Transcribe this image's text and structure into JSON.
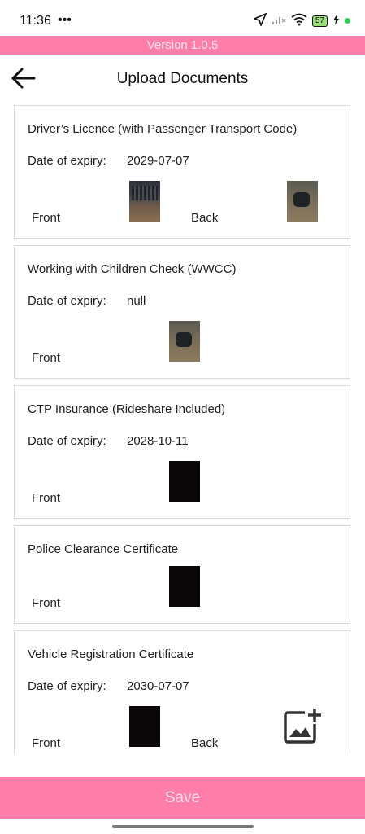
{
  "status": {
    "time": "11:36",
    "extra": "•••",
    "battery": "57"
  },
  "version": "Version 1.0.5",
  "header": {
    "title": "Upload Documents"
  },
  "labels": {
    "expiry": "Date of expiry:",
    "front": "Front",
    "back": "Back"
  },
  "documents": [
    {
      "title": "Driver’s Licence (with Passenger Transport Code)",
      "expiry": "2029-07-07"
    },
    {
      "title": "Working with Children Check (WWCC)",
      "expiry": "null"
    },
    {
      "title": "CTP Insurance (Rideshare Included)",
      "expiry": "2028-10-11"
    },
    {
      "title": "Police Clearance Certificate"
    },
    {
      "title": "Vehicle Registration Certificate",
      "expiry": "2030-07-07"
    }
  ],
  "save_label": "Save",
  "colors": {
    "accent": "#ff7ea9",
    "thumb_dark": "#0b0607",
    "card_border": "#d9d9d9"
  },
  "icons": {
    "back": "arrow-left-icon",
    "add_image": "add-photo-icon",
    "location": "location-arrow-icon",
    "wifi": "wifi-icon",
    "charging": "charging-icon"
  }
}
